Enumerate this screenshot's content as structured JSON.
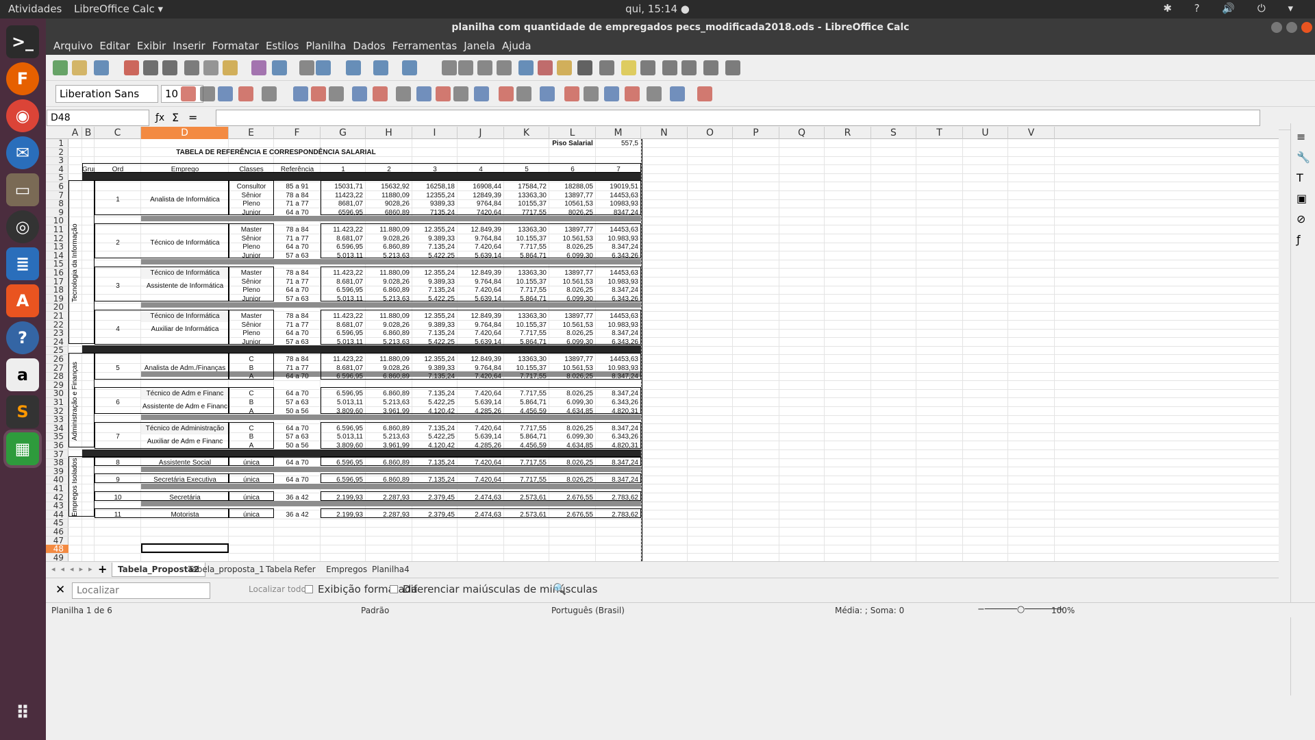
{
  "topbar": {
    "activities": "Atividades",
    "app_menu": "LibreOffice Calc ▾",
    "clock": "qui, 15:14 ●",
    "tray": "✱ ? 🔊 ⏻ ▾"
  },
  "window": {
    "title": "planilha com quantidade de empregados pecs_modificada2018.ods - LibreOffice Calc"
  },
  "menu": [
    "Arquivo",
    "Editar",
    "Exibir",
    "Inserir",
    "Formatar",
    "Estilos",
    "Planilha",
    "Dados",
    "Ferramentas",
    "Janela",
    "Ajuda"
  ],
  "format": {
    "font": "Liberation Sans",
    "size": "10"
  },
  "namebox": "D48",
  "columns": [
    "A",
    "B",
    "C",
    "D",
    "E",
    "F",
    "G",
    "H",
    "I",
    "J",
    "K",
    "L",
    "M",
    "N",
    "O",
    "P",
    "Q",
    "R",
    "S",
    "T",
    "U",
    "V"
  ],
  "rows": [
    "1",
    "2",
    "3",
    "4",
    "5",
    "6",
    "7",
    "8",
    "9",
    "10",
    "11",
    "12",
    "13",
    "14",
    "15",
    "16",
    "17",
    "18",
    "19",
    "20",
    "21",
    "22",
    "23",
    "24",
    "25",
    "26",
    "27",
    "28",
    "29",
    "30",
    "31",
    "32",
    "33",
    "34",
    "35",
    "36",
    "37",
    "38",
    "39",
    "40",
    "41",
    "42",
    "43",
    "44",
    "45",
    "46",
    "47",
    "48",
    "49"
  ],
  "sheet": {
    "piso_label": "Piso Salarial",
    "piso_value": "557,5",
    "title": "TABELA DE REFERÊNCIA E CORRESPONDÊNCIA SALARIAL",
    "headers": [
      "Grupo",
      "Ord",
      "Emprego",
      "Classes",
      "Referência",
      "1",
      "2",
      "3",
      "4",
      "5",
      "6",
      "7"
    ],
    "groups": [
      "Tecnologia da Informação",
      "Administração e Finanças",
      "Empregos Isolados"
    ],
    "blocks": [
      {
        "ord": "1",
        "jobs": [
          "Analista de Informática"
        ],
        "rows": [
          [
            "Consultor",
            "85 a 91",
            "15031,71",
            "15632,92",
            "16258,18",
            "16908,44",
            "17584,72",
            "18288,05",
            "19019,51"
          ],
          [
            "Sênior",
            "78 a 84",
            "11423,22",
            "11880,09",
            "12355,24",
            "12849,39",
            "13363,30",
            "13897,77",
            "14453,63"
          ],
          [
            "Pleno",
            "71 a 77",
            "8681,07",
            "9028,26",
            "9389,33",
            "9764,84",
            "10155,37",
            "10561,53",
            "10983,93"
          ],
          [
            "Junior",
            "64 a 70",
            "6596,95",
            "6860,89",
            "7135,24",
            "7420,64",
            "7717,55",
            "8026,25",
            "8347,24"
          ]
        ]
      },
      {
        "ord": "2",
        "jobs": [
          "Técnico de Informática"
        ],
        "rows": [
          [
            "Master",
            "78 a 84",
            "11.423,22",
            "11.880,09",
            "12.355,24",
            "12.849,39",
            "13363,30",
            "13897,77",
            "14453,63"
          ],
          [
            "Sênior",
            "71 a 77",
            "8.681,07",
            "9.028,26",
            "9.389,33",
            "9.764,84",
            "10.155,37",
            "10.561,53",
            "10.983,93"
          ],
          [
            "Pleno",
            "64 a 70",
            "6.596,95",
            "6.860,89",
            "7.135,24",
            "7.420,64",
            "7.717,55",
            "8.026,25",
            "8.347,24"
          ],
          [
            "Junior",
            "57 a 63",
            "5.013,11",
            "5.213,63",
            "5.422,25",
            "5.639,14",
            "5.864,71",
            "6.099,30",
            "6.343,26"
          ]
        ]
      },
      {
        "ord": "3",
        "jobs": [
          "Técnico de Informática",
          "Assistente de Informática"
        ],
        "rows": [
          [
            "Master",
            "78 a 84",
            "11.423,22",
            "11.880,09",
            "12.355,24",
            "12.849,39",
            "13363,30",
            "13897,77",
            "14453,63"
          ],
          [
            "Sênior",
            "71 a 77",
            "8.681,07",
            "9.028,26",
            "9.389,33",
            "9.764,84",
            "10.155,37",
            "10.561,53",
            "10.983,93"
          ],
          [
            "Pleno",
            "64 a 70",
            "6.596,95",
            "6.860,89",
            "7.135,24",
            "7.420,64",
            "7.717,55",
            "8.026,25",
            "8.347,24"
          ],
          [
            "Junior",
            "57 a 63",
            "5.013,11",
            "5.213,63",
            "5.422,25",
            "5.639,14",
            "5.864,71",
            "6.099,30",
            "6.343,26"
          ]
        ]
      },
      {
        "ord": "4",
        "jobs": [
          "Técnico de Informática",
          "Auxiliar de Informática"
        ],
        "rows": [
          [
            "Master",
            "78 a 84",
            "11.423,22",
            "11.880,09",
            "12.355,24",
            "12.849,39",
            "13363,30",
            "13897,77",
            "14453,63"
          ],
          [
            "Sênior",
            "71 a 77",
            "8.681,07",
            "9.028,26",
            "9.389,33",
            "9.764,84",
            "10.155,37",
            "10.561,53",
            "10.983,93"
          ],
          [
            "Pleno",
            "64 a 70",
            "6.596,95",
            "6.860,89",
            "7.135,24",
            "7.420,64",
            "7.717,55",
            "8.026,25",
            "8.347,24"
          ],
          [
            "Junior",
            "57 a 63",
            "5.013,11",
            "5.213,63",
            "5.422,25",
            "5.639,14",
            "5.864,71",
            "6.099,30",
            "6.343,26"
          ]
        ]
      },
      {
        "ord": "5",
        "jobs": [
          "Analista de Adm./Finanças"
        ],
        "rows": [
          [
            "C",
            "78 a 84",
            "11.423,22",
            "11.880,09",
            "12.355,24",
            "12.849,39",
            "13363,30",
            "13897,77",
            "14453,63"
          ],
          [
            "B",
            "71 a 77",
            "8.681,07",
            "9.028,26",
            "9.389,33",
            "9.764,84",
            "10.155,37",
            "10.561,53",
            "10.983,93"
          ],
          [
            "A",
            "64 a 70",
            "6.596,95",
            "6.860,89",
            "7.135,24",
            "7.420,64",
            "7.717,55",
            "8.026,25",
            "8.347,24"
          ]
        ]
      },
      {
        "ord": "6",
        "jobs": [
          "Técnico de Adm e Financ",
          "Assistente de Adm e Financ"
        ],
        "rows": [
          [
            "C",
            "64 a 70",
            "6.596,95",
            "6.860,89",
            "7.135,24",
            "7.420,64",
            "7.717,55",
            "8.026,25",
            "8.347,24"
          ],
          [
            "B",
            "57 a 63",
            "5.013,11",
            "5.213,63",
            "5.422,25",
            "5.639,14",
            "5.864,71",
            "6.099,30",
            "6.343,26"
          ],
          [
            "A",
            "50 a 56",
            "3.809,60",
            "3.961,99",
            "4.120,42",
            "4.285,26",
            "4.456,59",
            "4.634,85",
            "4.820,31"
          ]
        ]
      },
      {
        "ord": "7",
        "jobs": [
          "Técnico de Administração",
          "Auxiliar de Adm e Financ"
        ],
        "rows": [
          [
            "C",
            "64 a 70",
            "6.596,95",
            "6.860,89",
            "7.135,24",
            "7.420,64",
            "7.717,55",
            "8.026,25",
            "8.347,24"
          ],
          [
            "B",
            "57 a 63",
            "5.013,11",
            "5.213,63",
            "5.422,25",
            "5.639,14",
            "5.864,71",
            "6.099,30",
            "6.343,26"
          ],
          [
            "A",
            "50 a 56",
            "3.809,60",
            "3.961,99",
            "4.120,42",
            "4.285,26",
            "4.456,59",
            "4.634,85",
            "4.820,31"
          ]
        ]
      },
      {
        "ord": "8",
        "jobs": [
          "Assistente Social"
        ],
        "rows": [
          [
            "única",
            "64 a 70",
            "6.596,95",
            "6.860,89",
            "7.135,24",
            "7.420,64",
            "7.717,55",
            "8.026,25",
            "8.347,24"
          ]
        ]
      },
      {
        "ord": "9",
        "jobs": [
          "Secretária Executiva"
        ],
        "rows": [
          [
            "única",
            "64 a 70",
            "6.596,95",
            "6.860,89",
            "7.135,24",
            "7.420,64",
            "7.717,55",
            "8.026,25",
            "8.347,24"
          ]
        ]
      },
      {
        "ord": "10",
        "jobs": [
          "Secretária"
        ],
        "rows": [
          [
            "única",
            "36 a 42",
            "2.199,93",
            "2.287,93",
            "2.379,45",
            "2.474,63",
            "2.573,61",
            "2.676,55",
            "2.783,62"
          ]
        ]
      },
      {
        "ord": "11",
        "jobs": [
          "Motorista"
        ],
        "rows": [
          [
            "única",
            "36 a 42",
            "2.199,93",
            "2.287,93",
            "2.379,45",
            "2.474,63",
            "2.573,61",
            "2.676,55",
            "2.783,62"
          ]
        ]
      }
    ]
  },
  "tabs": [
    "Tabela_Proposta2",
    "Tabela_proposta_1",
    "Tabela",
    "Refer",
    "Empregos",
    "Planilha4"
  ],
  "find": {
    "placeholder": "Localizar",
    "find_all": "Localizar todos",
    "formatted": "Exibição formatada",
    "match_case": "Diferenciar maiúsculas de minúsculas"
  },
  "status": {
    "sheet": "Planilha 1 de 6",
    "style": "Padrão",
    "lang": "Português (Brasil)",
    "sum": "Média: ; Soma: 0",
    "zoom": "100%"
  }
}
